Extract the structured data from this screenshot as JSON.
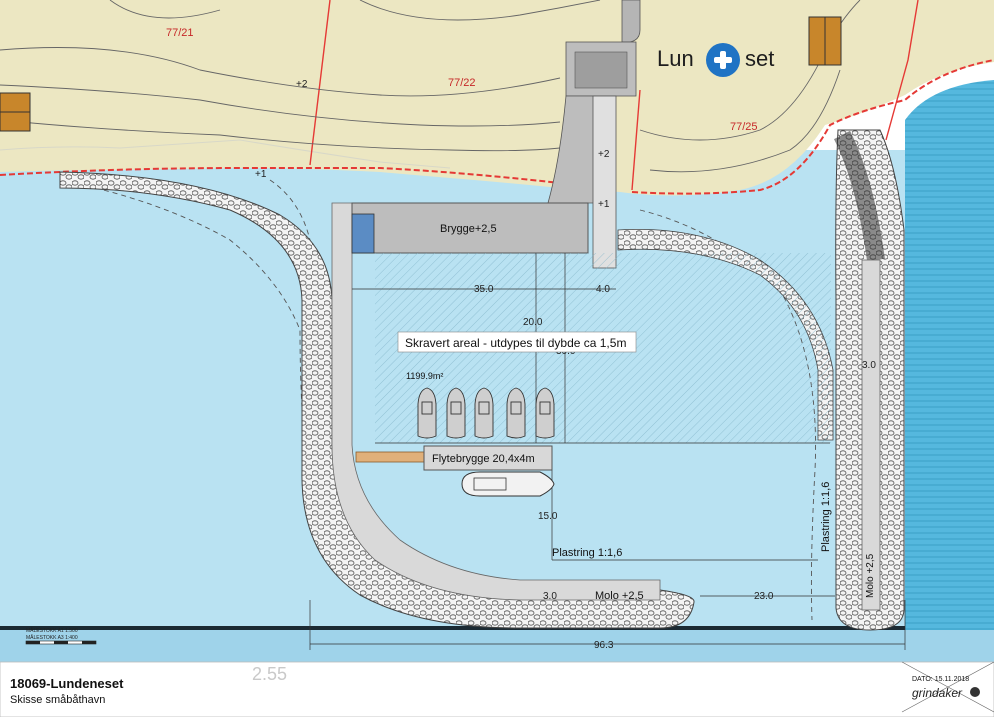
{
  "plot_numbers": [
    "77/21",
    "77/22",
    "77/25"
  ],
  "logo": {
    "left": "Lun",
    "right": "set"
  },
  "contour_labels": {
    "c2_a": "+2",
    "c1_a": "+1",
    "c2_b": "+2",
    "c1_b": "+1"
  },
  "labels": {
    "brygge": "Brygge+2,5",
    "dredge": "Skravert areal - utdypes til dybde ca 1,5m",
    "area": "1199.9m²",
    "flytebrygge": "Flytebrygge 20,4x4m",
    "plastring_bottom": "Plastring 1:1,6",
    "plastring_right": "Plastring 1:1,6",
    "molo_bottom": "Molo +2,5",
    "molo_right": "Molo +2,5"
  },
  "dimensions": {
    "d35": "35.0",
    "d4": "4.0",
    "d20": "20.0",
    "d30_hidden": "30.0",
    "d15": "15.0",
    "d3_bottom": "3.0",
    "d23": "23.0",
    "d3_right": "3.0",
    "d96": "96.3"
  },
  "title_block": {
    "project": "18069-Lundeneset",
    "subtitle": "Skisse småbåthavn",
    "sheet_no": "2.55",
    "date": "DATO: 15.11.2018",
    "company": "grindaker",
    "scale_a1": "MÅLESTOKK  A1   1:500",
    "scale_a3": "MÅLESTOKK  A3   1:400"
  },
  "colors": {
    "land": "#ece7c2",
    "water": "#b9e2f2",
    "deep_water": "#55b8de",
    "red_line": "#e53935",
    "pier": "#bdbdbd",
    "boat_fill": "#cfcfcf",
    "gangway": "#e0b07a"
  }
}
